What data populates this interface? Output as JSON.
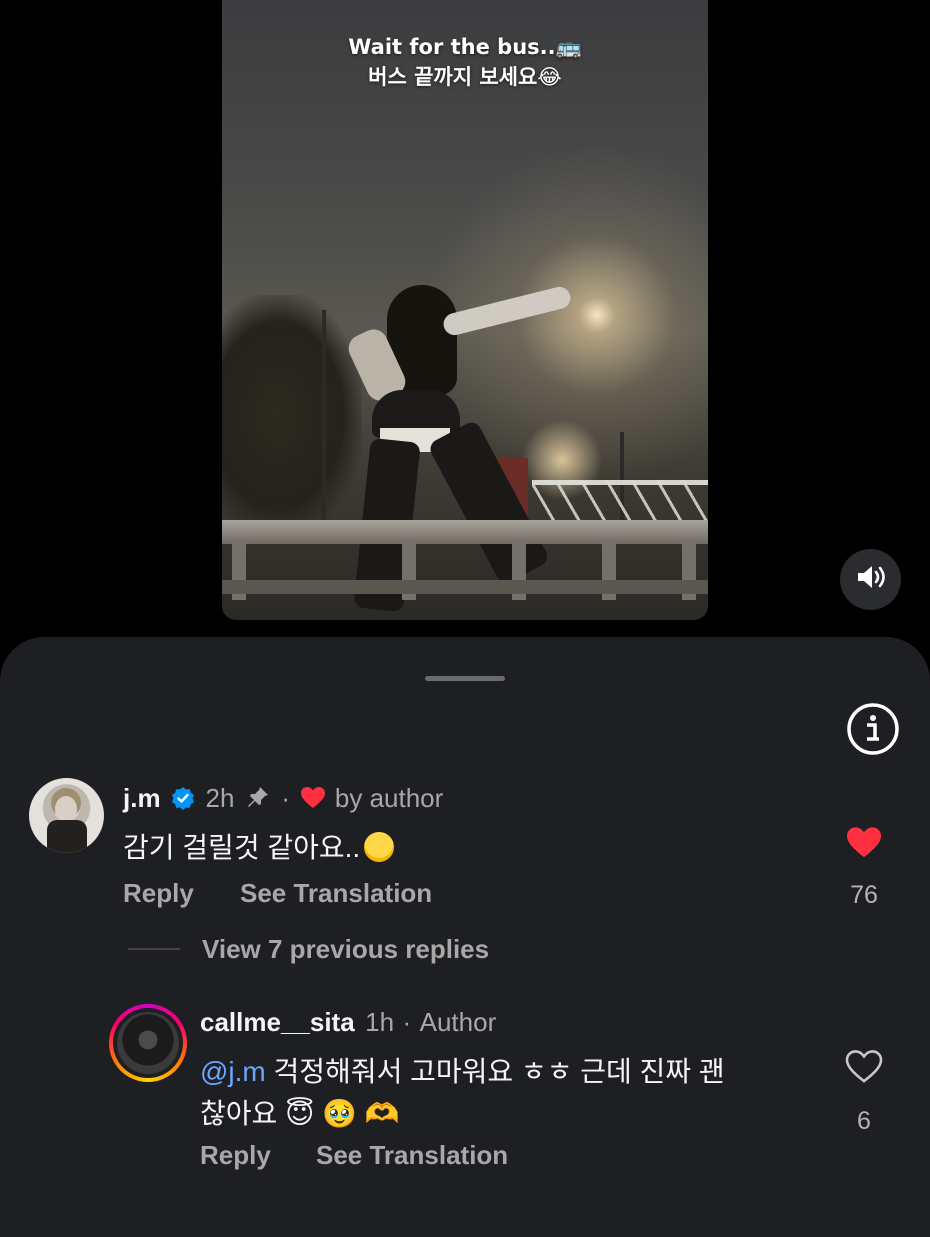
{
  "video": {
    "caption_line1": "Wait for the bus..🚌",
    "caption_line2": "버스 끝까지 보세요😂",
    "sound_button": "speaker-icon"
  },
  "sheet": {
    "info_icon": "info-icon"
  },
  "comment": {
    "username": "j.m",
    "verified_icon": "verified-badge-icon",
    "time": "2h",
    "pin_icon": "pin-icon",
    "separator": "·",
    "liked_by_author": "by author",
    "text": "감기 걸릴것 같아요..",
    "text_emoji": "😢",
    "reply": "Reply",
    "see_translation": "See Translation",
    "like_count": "76",
    "liked": true,
    "accent_color": "#ff3040"
  },
  "view_replies": "View 7 previous replies",
  "reply": {
    "username": "callme__sita",
    "time": "1h",
    "separator": "·",
    "author_label": "Author",
    "mention": "@j.m",
    "text_line1": "걱정해줘서 고마워요 ㅎㅎ 근데 진짜 괜",
    "text_line2": "찮아요",
    "emojis": "😇 🥹 🫶",
    "reply": "Reply",
    "see_translation": "See Translation",
    "like_count": "6",
    "liked": false
  }
}
